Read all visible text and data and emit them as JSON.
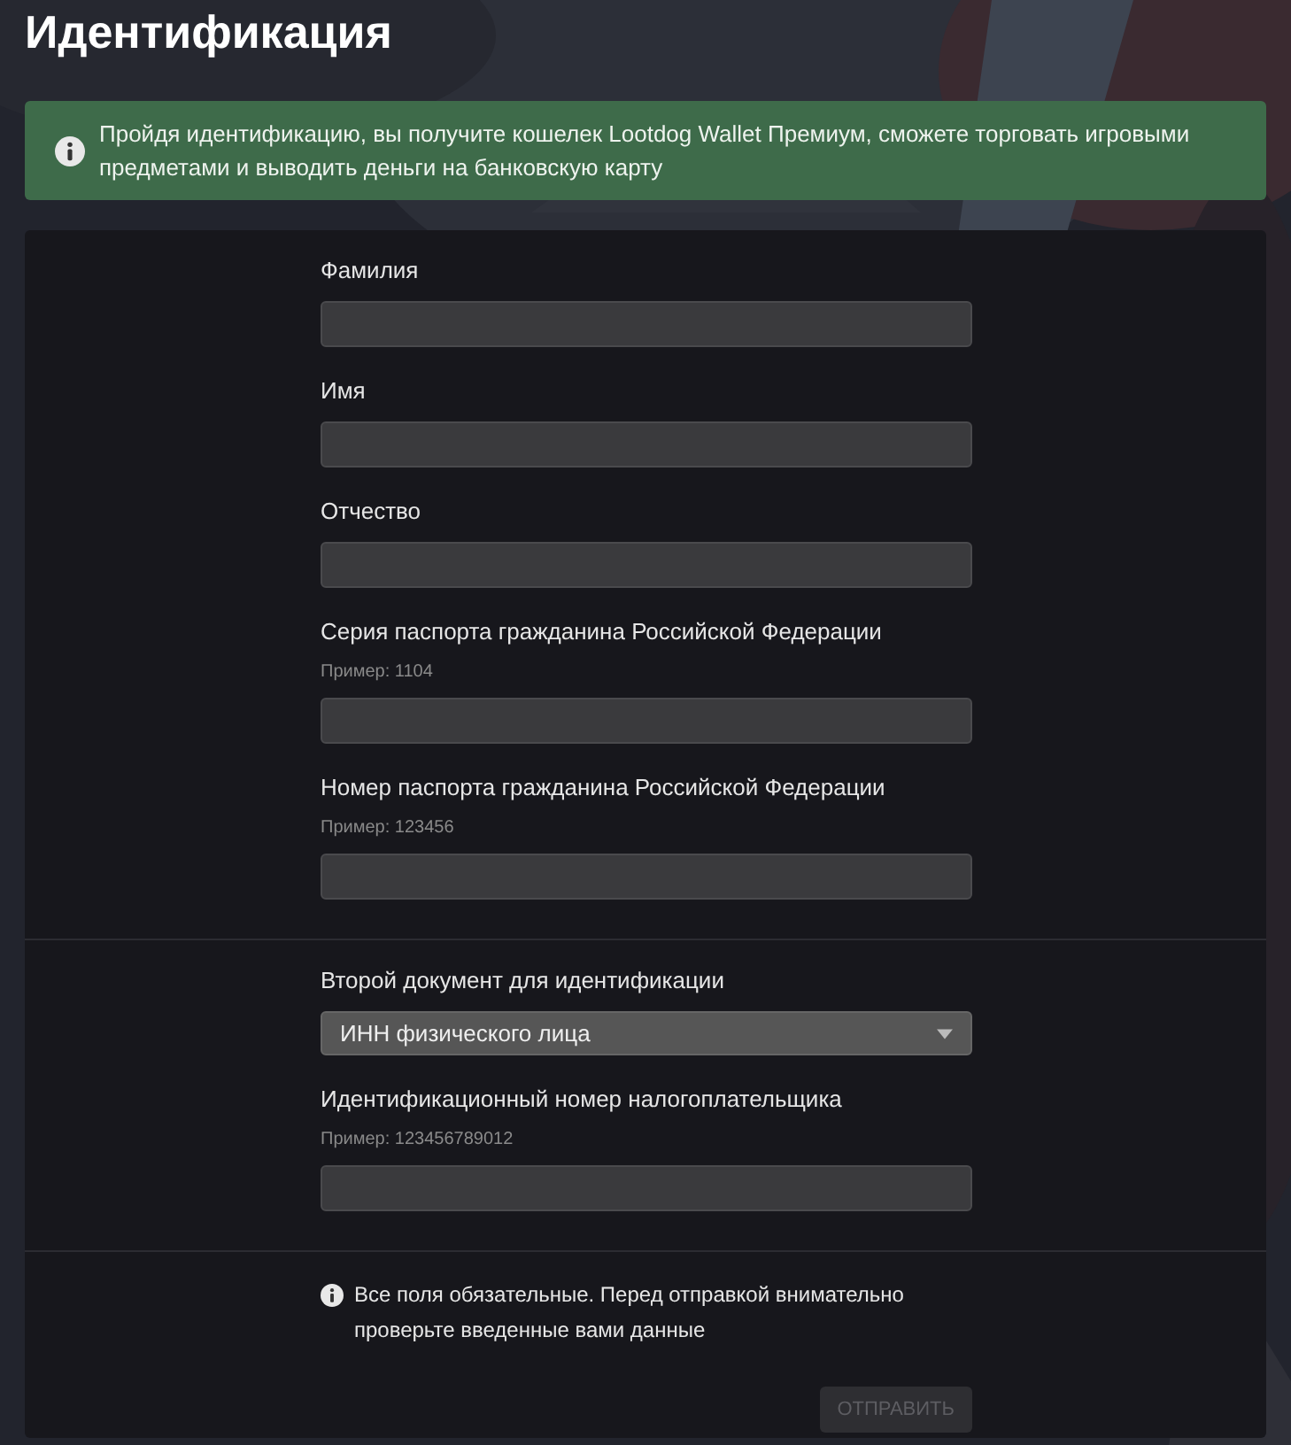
{
  "title": "Идентификация",
  "notice": {
    "text": "Пройдя идентификацию, вы получите кошелек Lootdog Wallet Премиум, сможете торговать игровыми предметами и выводить деньги на банковскую карту"
  },
  "sections": [
    {
      "fields": [
        {
          "kind": "text",
          "label": "Фамилия"
        },
        {
          "kind": "text",
          "label": "Имя"
        },
        {
          "kind": "text",
          "label": "Отчество"
        },
        {
          "kind": "text",
          "label": "Серия паспорта гражданина Российской Федерации",
          "hint": "Пример: 1104"
        },
        {
          "kind": "text",
          "label": "Номер паспорта гражданина Российской Федерации",
          "hint": "Пример: 123456"
        }
      ]
    },
    {
      "fields": [
        {
          "kind": "select",
          "label": "Второй документ для идентификации",
          "value": "ИНН физического лица"
        },
        {
          "kind": "text",
          "label": "Идентификационный номер налогоплательщика",
          "hint": "Пример: 123456789012"
        }
      ]
    }
  ],
  "footer": {
    "note": "Все поля обязательные. Перед отправкой внимательно проверьте введенные вами данные",
    "submit": {
      "label": "ОТПРАВИТЬ",
      "disabled": true
    }
  }
}
